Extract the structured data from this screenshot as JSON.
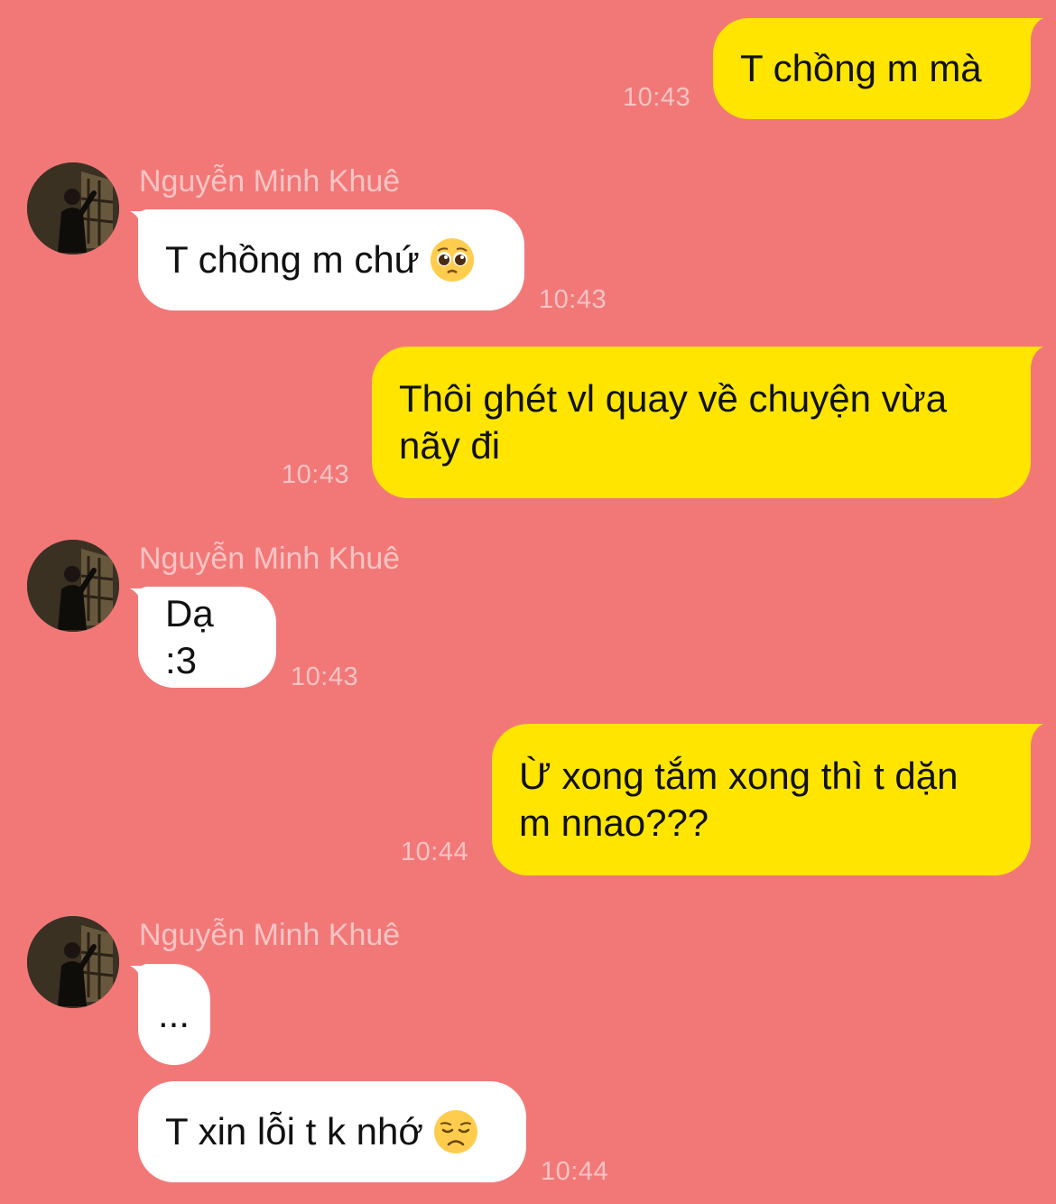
{
  "colors": {
    "background": "#F27878",
    "outgoing_bubble": "#FFE500",
    "incoming_bubble": "#FFFFFF",
    "timestamp": "#F8C3C3",
    "sender_name": "#F9C4C4"
  },
  "messages": [
    {
      "direction": "out",
      "text": "T chồng m mà",
      "time": "10:43"
    },
    {
      "direction": "in",
      "sender": "Nguyễn Minh Khuê",
      "text": "T chồng m chứ",
      "emoji": "pleading-face",
      "time": "10:43"
    },
    {
      "direction": "out",
      "text": "Thôi ghét vl quay về chuyện vừa\nnãy đi",
      "time": "10:43"
    },
    {
      "direction": "in",
      "sender": "Nguyễn Minh Khuê",
      "text": "Dạ :3",
      "time": "10:43"
    },
    {
      "direction": "out",
      "text": "Ừ xong tắm xong thì t dặn\nm nnao???",
      "time": "10:44"
    },
    {
      "direction": "in",
      "sender": "Nguyễn Minh Khuê",
      "text": "..."
    },
    {
      "direction": "in",
      "text": "T xin lỗi t k nhớ",
      "emoji": "disappointed-face",
      "time": "10:44"
    }
  ]
}
